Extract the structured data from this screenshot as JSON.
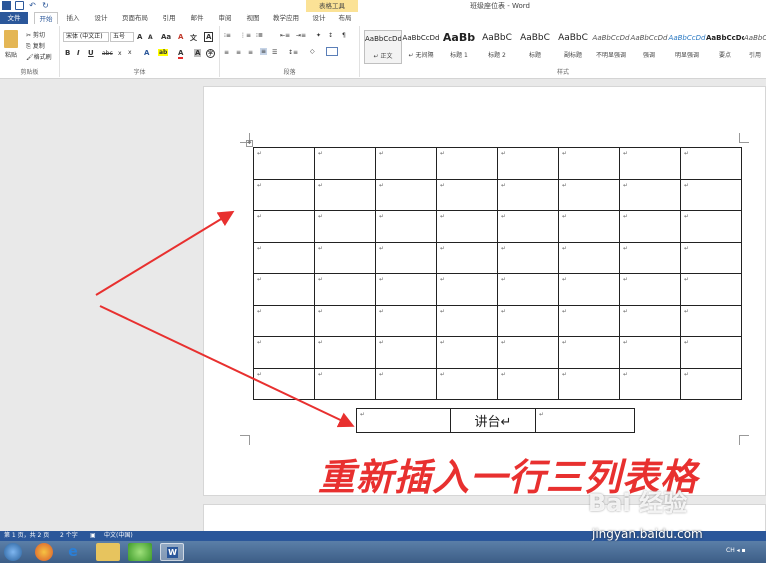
{
  "window": {
    "title": "班级座位表 - Word",
    "context_group": "表格工具"
  },
  "tabs": {
    "file": "文件",
    "home": "开始",
    "insert": "插入",
    "design": "设计",
    "page_layout": "页面布局",
    "references": "引用",
    "mailings": "邮件",
    "review": "审阅",
    "view": "视图",
    "teaching": "教学应用",
    "table_design": "设计",
    "table_layout": "布局"
  },
  "ribbon": {
    "clipboard": {
      "paste": "粘贴",
      "cut": "剪切",
      "copy": "复制",
      "format_painter": "格式刷",
      "label": "剪贴板"
    },
    "font": {
      "font_name": "宋体 (中文正)",
      "font_size": "五号",
      "label": "字体",
      "wen": "wén",
      "grow": "A",
      "shrink": "A",
      "case": "Aa",
      "clear": "A",
      "phonetic": "文",
      "border": "A",
      "bold": "B",
      "italic": "I",
      "underline": "U",
      "strike": "abc",
      "subscript": "x",
      "superscript": "x",
      "effects": "A",
      "highlight": "ab",
      "color": "A",
      "shade": "A",
      "enclose": "字"
    },
    "paragraph": {
      "label": "段落"
    },
    "styles": {
      "label": "样式",
      "items": [
        {
          "preview": "AaBbCcDd",
          "name": "↵ 正文"
        },
        {
          "preview": "AaBbCcDd",
          "name": "↵ 无间隔"
        },
        {
          "preview": "AaBb",
          "name": "标题 1"
        },
        {
          "preview": "AaBbC",
          "name": "标题 2"
        },
        {
          "preview": "AaBbC",
          "name": "标题"
        },
        {
          "preview": "AaBbC",
          "name": "副标题"
        },
        {
          "preview": "AaBbCcDd",
          "name": "不明显强调"
        },
        {
          "preview": "AaBbCcDd",
          "name": "强调"
        },
        {
          "preview": "AaBbCcDd",
          "name": "明显强调"
        },
        {
          "preview": "AaBbCcDd",
          "name": "要点"
        },
        {
          "preview": "AaBbCcDd",
          "name": "引用"
        }
      ]
    }
  },
  "document": {
    "table": {
      "rows": 8,
      "cols": 8,
      "cell_mark": "↵"
    },
    "podium_table": {
      "cells": [
        "↵",
        "讲台↵",
        "↵"
      ]
    },
    "annotation": "重新插入一行三列表格"
  },
  "statusbar": {
    "page": "第 1 页，共 2 页",
    "words": "2 个字",
    "language": "中文(中国)"
  },
  "watermark": {
    "brand": "Bai 经验",
    "url": "jingyan.baidu.com"
  },
  "colors": {
    "accent": "#2b579a",
    "annotation": "#e8302f",
    "context_tab": "#fbe296"
  }
}
